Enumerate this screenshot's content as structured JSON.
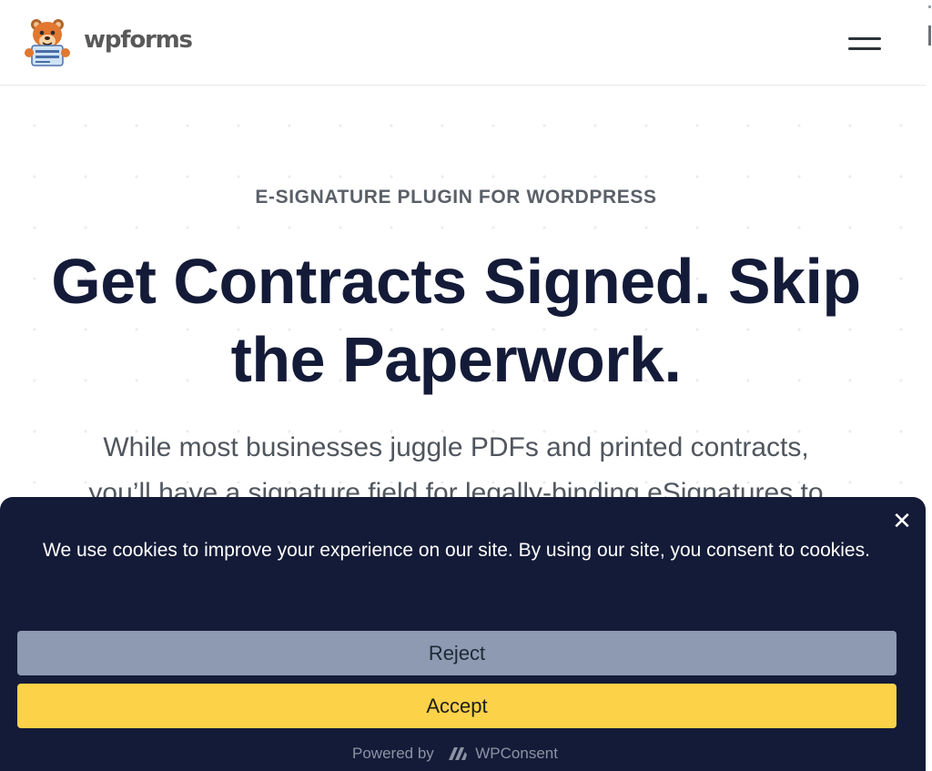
{
  "header": {
    "logo_text": "wpforms",
    "logo_icon": "bear-mascot-icon",
    "menu_icon": "hamburger-menu-icon"
  },
  "hero": {
    "eyebrow": "E-SIGNATURE PLUGIN FOR WORDPRESS",
    "headline_line1": "Get Contracts Signed. Skip",
    "headline_line2": "the Paperwork.",
    "lead_line1": "While most businesses juggle PDFs and printed contracts,",
    "lead_line2": "you’ll have a signature field for legally-binding eSignatures to"
  },
  "cookie_banner": {
    "message": "We use cookies to improve your experience on our site. By using our site, you consent to cookies.",
    "close_icon": "close-icon",
    "reject_label": "Reject",
    "accept_label": "Accept",
    "powered_by_label": "Powered by",
    "powered_by_brand": "WPConsent"
  },
  "colors": {
    "banner_bg": "#141b38",
    "reject_bg": "#8d9ab1",
    "accept_bg": "#fcd248",
    "headline": "#141b38",
    "logo_accent": "#e27730"
  }
}
